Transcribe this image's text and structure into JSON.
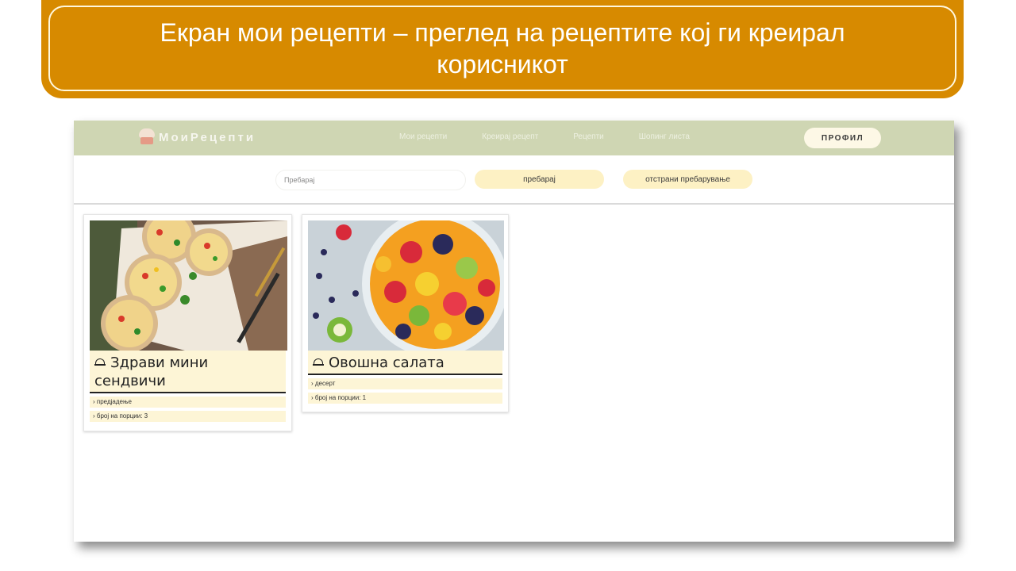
{
  "slide": {
    "title": "Екран мои рецепти – преглед на рецептите кој ги креирал корисникот"
  },
  "app": {
    "brand": "МоиРецепти",
    "nav": [
      {
        "label": "Мои рецепти"
      },
      {
        "label": "Креирај рецепт"
      },
      {
        "label": "Рецепти"
      },
      {
        "label": "Шопинг листа"
      }
    ],
    "profile_label": "ПРОФИЛ",
    "search": {
      "placeholder": "Пребарај",
      "search_button": "пребарај",
      "clear_button": "отстрани пребарување"
    },
    "recipes": [
      {
        "title": "Здрави мини сендвичи",
        "category": "› предјадење",
        "servings": "› број на порции: 3"
      },
      {
        "title": "Овошна салата",
        "category": "› десерт",
        "servings": "› број на порции: 1"
      }
    ]
  },
  "colors": {
    "banner": "#d78a00",
    "navbar": "#cfd6b3",
    "pill": "#fdf1c4",
    "card_label": "#fdf5d6"
  }
}
